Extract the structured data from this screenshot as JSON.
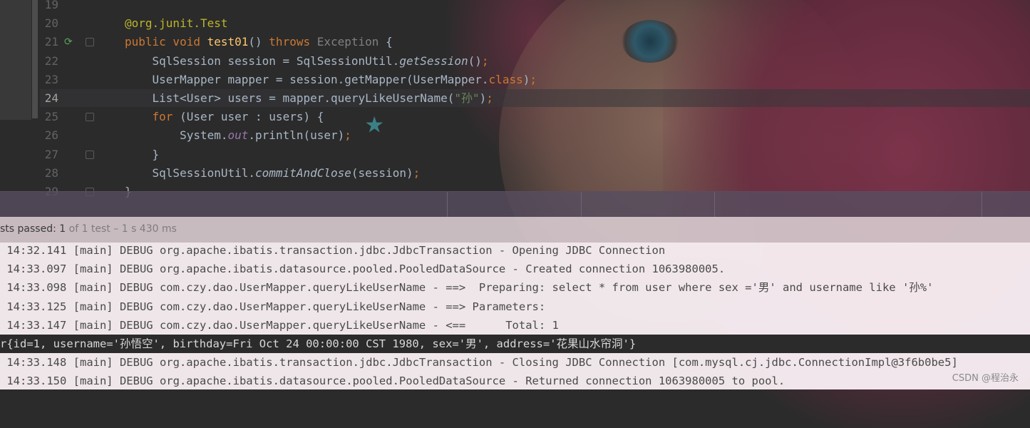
{
  "editor": {
    "lines": [
      {
        "num": "19",
        "segments": []
      },
      {
        "num": "20",
        "segments": [
          {
            "t": "@org.junit.",
            "c": "ann"
          },
          {
            "t": "Test",
            "c": "ann"
          }
        ]
      },
      {
        "num": "21",
        "segments": [
          {
            "t": "public void ",
            "c": "kw"
          },
          {
            "t": "test01",
            "c": "fn"
          },
          {
            "t": "() ",
            "c": ""
          },
          {
            "t": "throws ",
            "c": "kw"
          },
          {
            "t": "Exception",
            "c": "grey"
          },
          {
            "t": " {",
            "c": ""
          }
        ]
      },
      {
        "num": "22",
        "segments": [
          {
            "t": "    SqlSession session = SqlSessionUtil.",
            "c": ""
          },
          {
            "t": "getSession",
            "c": "ital"
          },
          {
            "t": "()",
            "c": ""
          },
          {
            "t": ";",
            "c": "kw"
          }
        ]
      },
      {
        "num": "23",
        "segments": [
          {
            "t": "    UserMapper mapper = session.getMapper(UserMapper.",
            "c": ""
          },
          {
            "t": "class",
            "c": "kw"
          },
          {
            "t": ")",
            "c": ""
          },
          {
            "t": ";",
            "c": "kw"
          }
        ]
      },
      {
        "num": "24",
        "segments": [
          {
            "t": "    List<User> users = mapper.queryLikeUserName(",
            "c": ""
          },
          {
            "t": "\"孙\"",
            "c": "str"
          },
          {
            "t": ")",
            "c": ""
          },
          {
            "t": ";",
            "c": "kw"
          }
        ]
      },
      {
        "num": "25",
        "segments": [
          {
            "t": "    ",
            "c": ""
          },
          {
            "t": "for",
            "c": "kw"
          },
          {
            "t": " (User user : users) {",
            "c": ""
          }
        ]
      },
      {
        "num": "26",
        "segments": [
          {
            "t": "        System.",
            "c": ""
          },
          {
            "t": "out",
            "c": "field"
          },
          {
            "t": ".println(user)",
            "c": ""
          },
          {
            "t": ";",
            "c": "kw"
          }
        ]
      },
      {
        "num": "27",
        "segments": [
          {
            "t": "    }",
            "c": ""
          }
        ]
      },
      {
        "num": "28",
        "segments": [
          {
            "t": "    SqlSessionUtil.",
            "c": ""
          },
          {
            "t": "commitAndClose",
            "c": "ital"
          },
          {
            "t": "(session)",
            "c": ""
          },
          {
            "t": ";",
            "c": "kw"
          }
        ]
      },
      {
        "num": "29",
        "segments": [
          {
            "t": "}",
            "c": ""
          }
        ]
      }
    ]
  },
  "status": {
    "prefix": "sts passed: ",
    "count": "1",
    "suffix": " of 1 test – 1 s 430 ms"
  },
  "console": {
    "lines": [
      {
        "text": " 14:32.141 [main] DEBUG org.apache.ibatis.transaction.jdbc.JdbcTransaction - Opening JDBC Connection",
        "type": "log"
      },
      {
        "text": " 14:33.097 [main] DEBUG org.apache.ibatis.datasource.pooled.PooledDataSource - Created connection 1063980005.",
        "type": "log"
      },
      {
        "text": " 14:33.098 [main] DEBUG com.czy.dao.UserMapper.queryLikeUserName - ==>  Preparing: select * from user where sex ='男' and username like '孙%'",
        "type": "log"
      },
      {
        "text": " 14:33.125 [main] DEBUG com.czy.dao.UserMapper.queryLikeUserName - ==> Parameters: ",
        "type": "log"
      },
      {
        "text": " 14:33.147 [main] DEBUG com.czy.dao.UserMapper.queryLikeUserName - <==      Total: 1",
        "type": "log"
      },
      {
        "text": "r{id=1, username='孙悟空', birthday=Fri Oct 24 00:00:00 CST 1980, sex='男', address='花果山水帘洞'}",
        "type": "out"
      },
      {
        "text": " 14:33.148 [main] DEBUG org.apache.ibatis.transaction.jdbc.JdbcTransaction - Closing JDBC Connection [com.mysql.cj.jdbc.ConnectionImpl@3f6b0be5]",
        "type": "log"
      },
      {
        "text": " 14:33.150 [main] DEBUG org.apache.ibatis.datasource.pooled.PooledDataSource - Returned connection 1063980005 to pool.",
        "type": "log"
      }
    ]
  },
  "watermark": "CSDN @程治永",
  "colors": {
    "editor_bg": "#2b2b2b",
    "keyword": "#cc7832",
    "function": "#ffc66d",
    "annotation": "#bbb529",
    "string": "#6a8759",
    "field": "#9876aa",
    "console_bg": "#f8eef2"
  },
  "icons": {
    "run_gutter": "run-test-icon",
    "fold": "fold-marker-icon"
  }
}
